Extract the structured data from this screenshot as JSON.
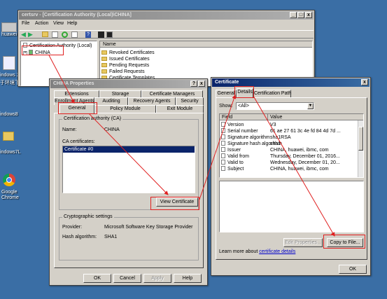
{
  "desktop": {
    "labels": [
      "huawei",
      "indows 2(",
      "于环境下",
      "indows8",
      "indows7L",
      "Google\nChrome"
    ]
  },
  "mmc": {
    "title": "certsrv - [Certification Authority (Local)\\CHINA]",
    "menu": [
      "File",
      "Action",
      "View",
      "Help"
    ],
    "tree_root": "Certification Authority (Local)",
    "tree_child": "CHINA",
    "list_header": "Name",
    "list_items": [
      "Revoked Certificates",
      "Issued Certificates",
      "Pending Requests",
      "Failed Requests",
      "Certificate Templates"
    ]
  },
  "props": {
    "title": "CHINA Properties",
    "tabs_row1": [
      "Extensions",
      "Storage",
      "Certificate Managers"
    ],
    "tabs_row2": [
      "Enrollment Agents",
      "Auditing",
      "Recovery Agents",
      "Security"
    ],
    "tabs_row3": [
      "General",
      "Policy Module",
      "Exit Module"
    ],
    "ca_group": "Certification authority (CA)",
    "name_label": "Name:",
    "name_value": "CHINA",
    "ca_certs_label": "CA certificates:",
    "cert_item": "Certificate #0",
    "view_cert": "View Certificate",
    "crypto_group": "Cryptographic settings",
    "provider_label": "Provider:",
    "provider_value": "Microsoft Software Key Storage Provider",
    "hash_label": "Hash algorithm:",
    "hash_value": "SHA1",
    "buttons": [
      "OK",
      "Cancel",
      "Apply",
      "Help"
    ]
  },
  "cert": {
    "title": "Certificate",
    "tabs": [
      "General",
      "Details",
      "Certification Path"
    ],
    "show_label": "Show:",
    "show_value": "<All>",
    "col_field": "Field",
    "col_value": "Value",
    "rows": [
      {
        "field": "Version",
        "value": "V3"
      },
      {
        "field": "Serial number",
        "value": "61 ae 27 61 3c 4e fd 84 4d 7d ..."
      },
      {
        "field": "Signature algorithm",
        "value": "sha1RSA"
      },
      {
        "field": "Signature hash algorithm",
        "value": "sha1"
      },
      {
        "field": "Issuer",
        "value": "CHINA, huawei, ibmc, com"
      },
      {
        "field": "Valid from",
        "value": "Thursday, December 01, 2016..."
      },
      {
        "field": "Valid to",
        "value": "Wednesday, December 01, 20..."
      },
      {
        "field": "Subject",
        "value": "CHINA, huawei, ibmc, com"
      }
    ],
    "edit_props": "Edit Properties...",
    "copy_to_file": "Copy to File...",
    "learn_prefix": "Learn more about",
    "learn_link": "certificate details",
    "ok": "OK"
  }
}
